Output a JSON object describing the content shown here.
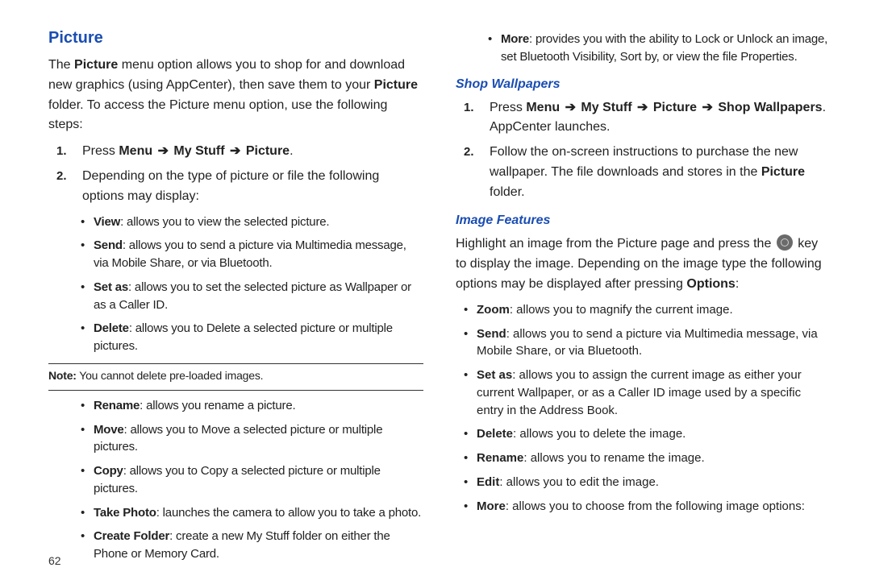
{
  "page_number": "62",
  "left": {
    "heading": "Picture",
    "intro_parts": {
      "p1": "The ",
      "p2": "Picture",
      "p3": " menu option allows you to shop for and download new graphics (using AppCenter), then save them to your ",
      "p4": "Picture",
      "p5": " folder. To access the Picture menu option, use the following steps:"
    },
    "step1": {
      "num": "1.",
      "t1": "Press ",
      "t2": "Menu",
      "t3": "My Stuff",
      "t4": "Picture",
      "t5": "."
    },
    "step2": {
      "num": "2.",
      "text": "Depending on the type of picture or file the following options may display:"
    },
    "opts_a": [
      {
        "label": "View",
        "desc": ": allows you to view the selected picture."
      },
      {
        "label": "Send",
        "desc": ": allows you to send a picture via Multimedia message, via Mobile Share, or via Bluetooth."
      },
      {
        "label": "Set as",
        "desc": ": allows you to set the selected picture as Wallpaper or as a Caller ID."
      },
      {
        "label": "Delete",
        "desc": ": allows you to Delete a selected picture or multiple pictures."
      }
    ],
    "note": {
      "label": "Note:",
      "text": " You cannot delete pre-loaded images."
    },
    "opts_b": [
      {
        "label": "Rename",
        "desc": ": allows you rename a picture."
      },
      {
        "label": "Move",
        "desc": ": allows you to Move a selected picture or multiple pictures."
      },
      {
        "label": "Copy",
        "desc": ": allows you to Copy a selected picture or multiple pictures."
      },
      {
        "label": "Take Photo",
        "desc": ": launches the camera to allow you to take a photo."
      },
      {
        "label": "Create Folder",
        "desc": ": create a new My Stuff folder on either the Phone or Memory Card."
      }
    ]
  },
  "right": {
    "top_bullet": {
      "label": "More",
      "desc": ": provides you with the ability to Lock or Unlock an image, set Bluetooth Visibility, Sort by, or view the file Properties."
    },
    "shop_heading": "Shop Wallpapers",
    "shop_step1": {
      "num": "1.",
      "t1": "Press ",
      "t2": "Menu",
      "t3": "My Stuff",
      "t4": "Picture",
      "t5": "Shop Wallpapers",
      "t6": ". AppCenter launches."
    },
    "shop_step2": {
      "num": "2.",
      "t1": "Follow the on-screen instructions to purchase the new wallpaper. The file downloads and stores in the ",
      "t2": "Picture",
      "t3": " folder."
    },
    "imgfeat_heading": "Image Features",
    "imgfeat_intro": {
      "t1": "Highlight an image from the Picture page and press the ",
      "t2": " key to display the image. Depending on the image type the following options may be displayed after pressing ",
      "t3": "Options",
      "t4": ":"
    },
    "imgfeat_opts": [
      {
        "label": "Zoom",
        "desc": ": allows you to magnify the current image."
      },
      {
        "label": "Send",
        "desc": ": allows you to send a picture via Multimedia message, via Mobile Share, or via Bluetooth."
      },
      {
        "label": "Set as",
        "desc": ": allows you to assign the current image as either your current Wallpaper, or as a Caller ID image used by a specific entry in the Address Book."
      },
      {
        "label": "Delete",
        "desc": ": allows you to delete the image."
      },
      {
        "label": "Rename",
        "desc": ": allows you to rename the image."
      },
      {
        "label": "Edit",
        "desc": ": allows you to edit the image."
      },
      {
        "label": "More",
        "desc": ": allows you to choose from the following image options:"
      }
    ]
  }
}
